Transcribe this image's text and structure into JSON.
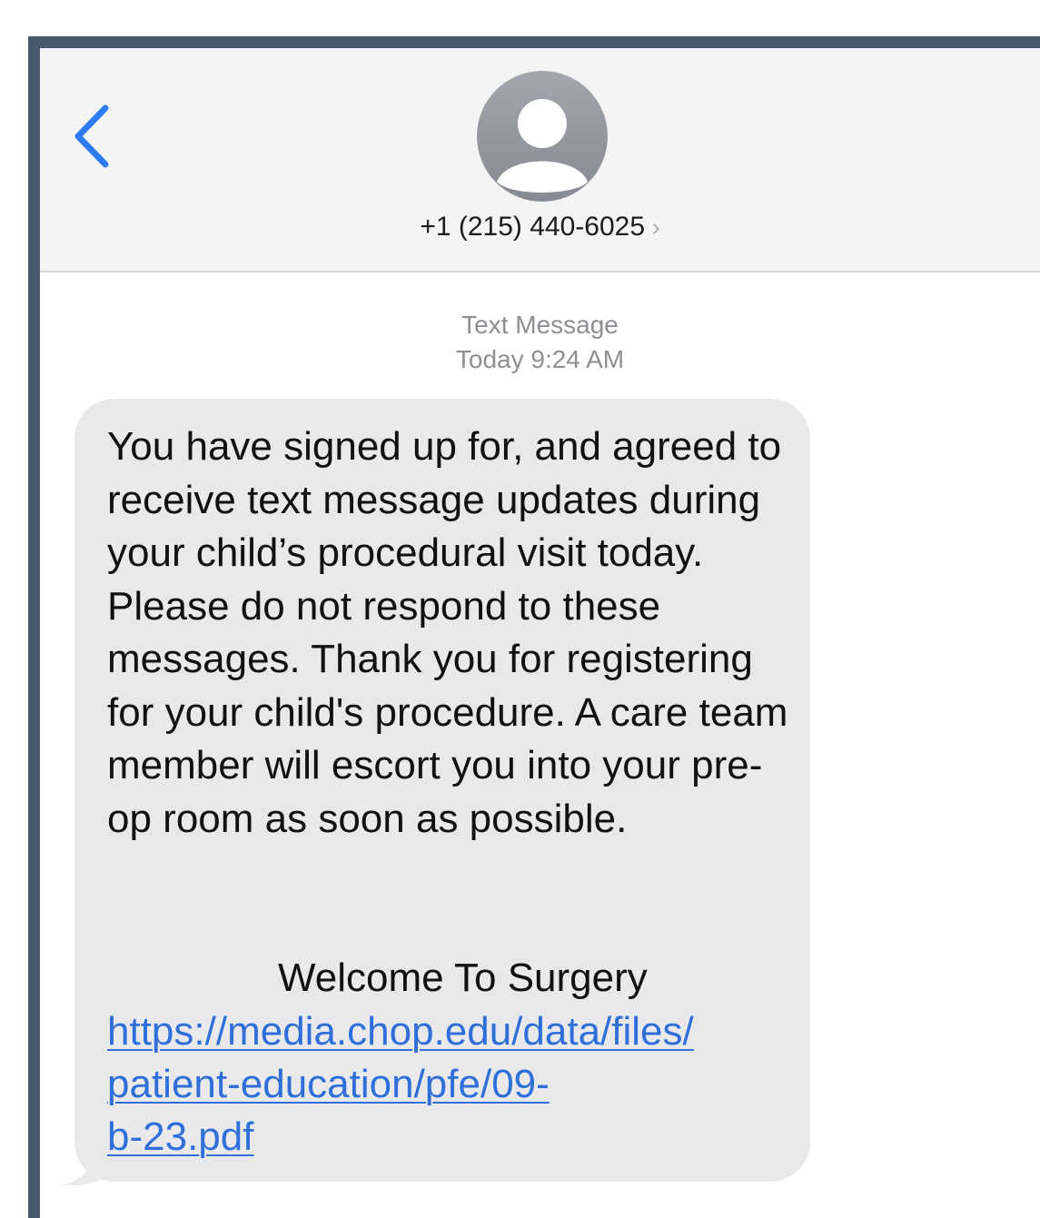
{
  "header": {
    "contact_number": "+1 (215) 440-6025",
    "contact_chevron": "›"
  },
  "conversation": {
    "service_label": "Text Message",
    "timestamp": "Today 9:24 AM"
  },
  "message": {
    "body": "You have signed up for, and agreed to receive text message updates during your child’s procedural visit today. Please do not respond to these messages. Thank you for registering for your child's procedure. A care team member will escort you into your pre-op room as soon as possible.",
    "welcome_title": "Welcome To Surgery",
    "link_line_1": "https://media.chop.edu/data/files/",
    "link_line_2": "patient-education/pfe/09-",
    "link_line_3": "b-23.pdf"
  },
  "colors": {
    "accent": "#2f7bf5",
    "bubble_gray": "#e9e9eb",
    "header_bg": "#f4f4f4",
    "meta_gray": "#8e8e93",
    "link_blue": "#2f6fd9"
  },
  "icons": {
    "back": "chevron-left-icon",
    "avatar": "person-avatar-icon"
  }
}
